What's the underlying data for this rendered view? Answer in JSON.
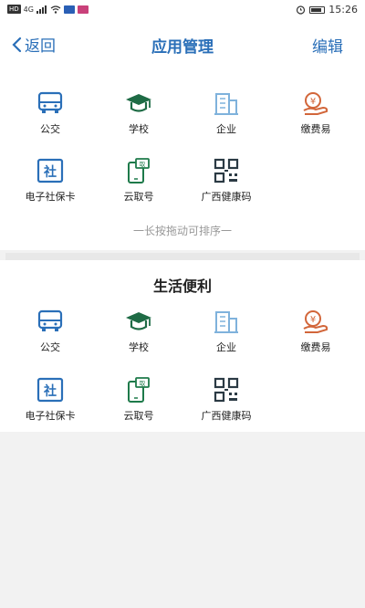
{
  "status_bar": {
    "left_tags": [
      "HD",
      "4G"
    ],
    "time": "15:26"
  },
  "header": {
    "back_label": "返回",
    "title": "应用管理",
    "edit_label": "编辑"
  },
  "section1": {
    "items": [
      {
        "label": "公交",
        "icon": "bus-icon"
      },
      {
        "label": "学校",
        "icon": "graduation-cap-icon"
      },
      {
        "label": "企业",
        "icon": "building-icon"
      },
      {
        "label": "缴费易",
        "icon": "payment-icon"
      },
      {
        "label": "电子社保卡",
        "icon": "social-security-card-icon"
      },
      {
        "label": "云取号",
        "icon": "queue-ticket-icon"
      },
      {
        "label": "广西健康码",
        "icon": "qr-code-icon"
      }
    ],
    "hint": "一长按拖动可排序一"
  },
  "section2": {
    "title": "生活便利",
    "items": [
      {
        "label": "公交",
        "icon": "bus-icon"
      },
      {
        "label": "学校",
        "icon": "graduation-cap-icon"
      },
      {
        "label": "企业",
        "icon": "building-icon"
      },
      {
        "label": "缴费易",
        "icon": "payment-icon"
      },
      {
        "label": "电子社保卡",
        "icon": "social-security-card-icon"
      },
      {
        "label": "云取号",
        "icon": "queue-ticket-icon"
      },
      {
        "label": "广西健康码",
        "icon": "qr-code-icon"
      }
    ]
  },
  "colors": {
    "accent": "#2a6fb8",
    "green": "#1e7a4a",
    "orange": "#d2663a",
    "light_blue": "#7fb2dc"
  }
}
